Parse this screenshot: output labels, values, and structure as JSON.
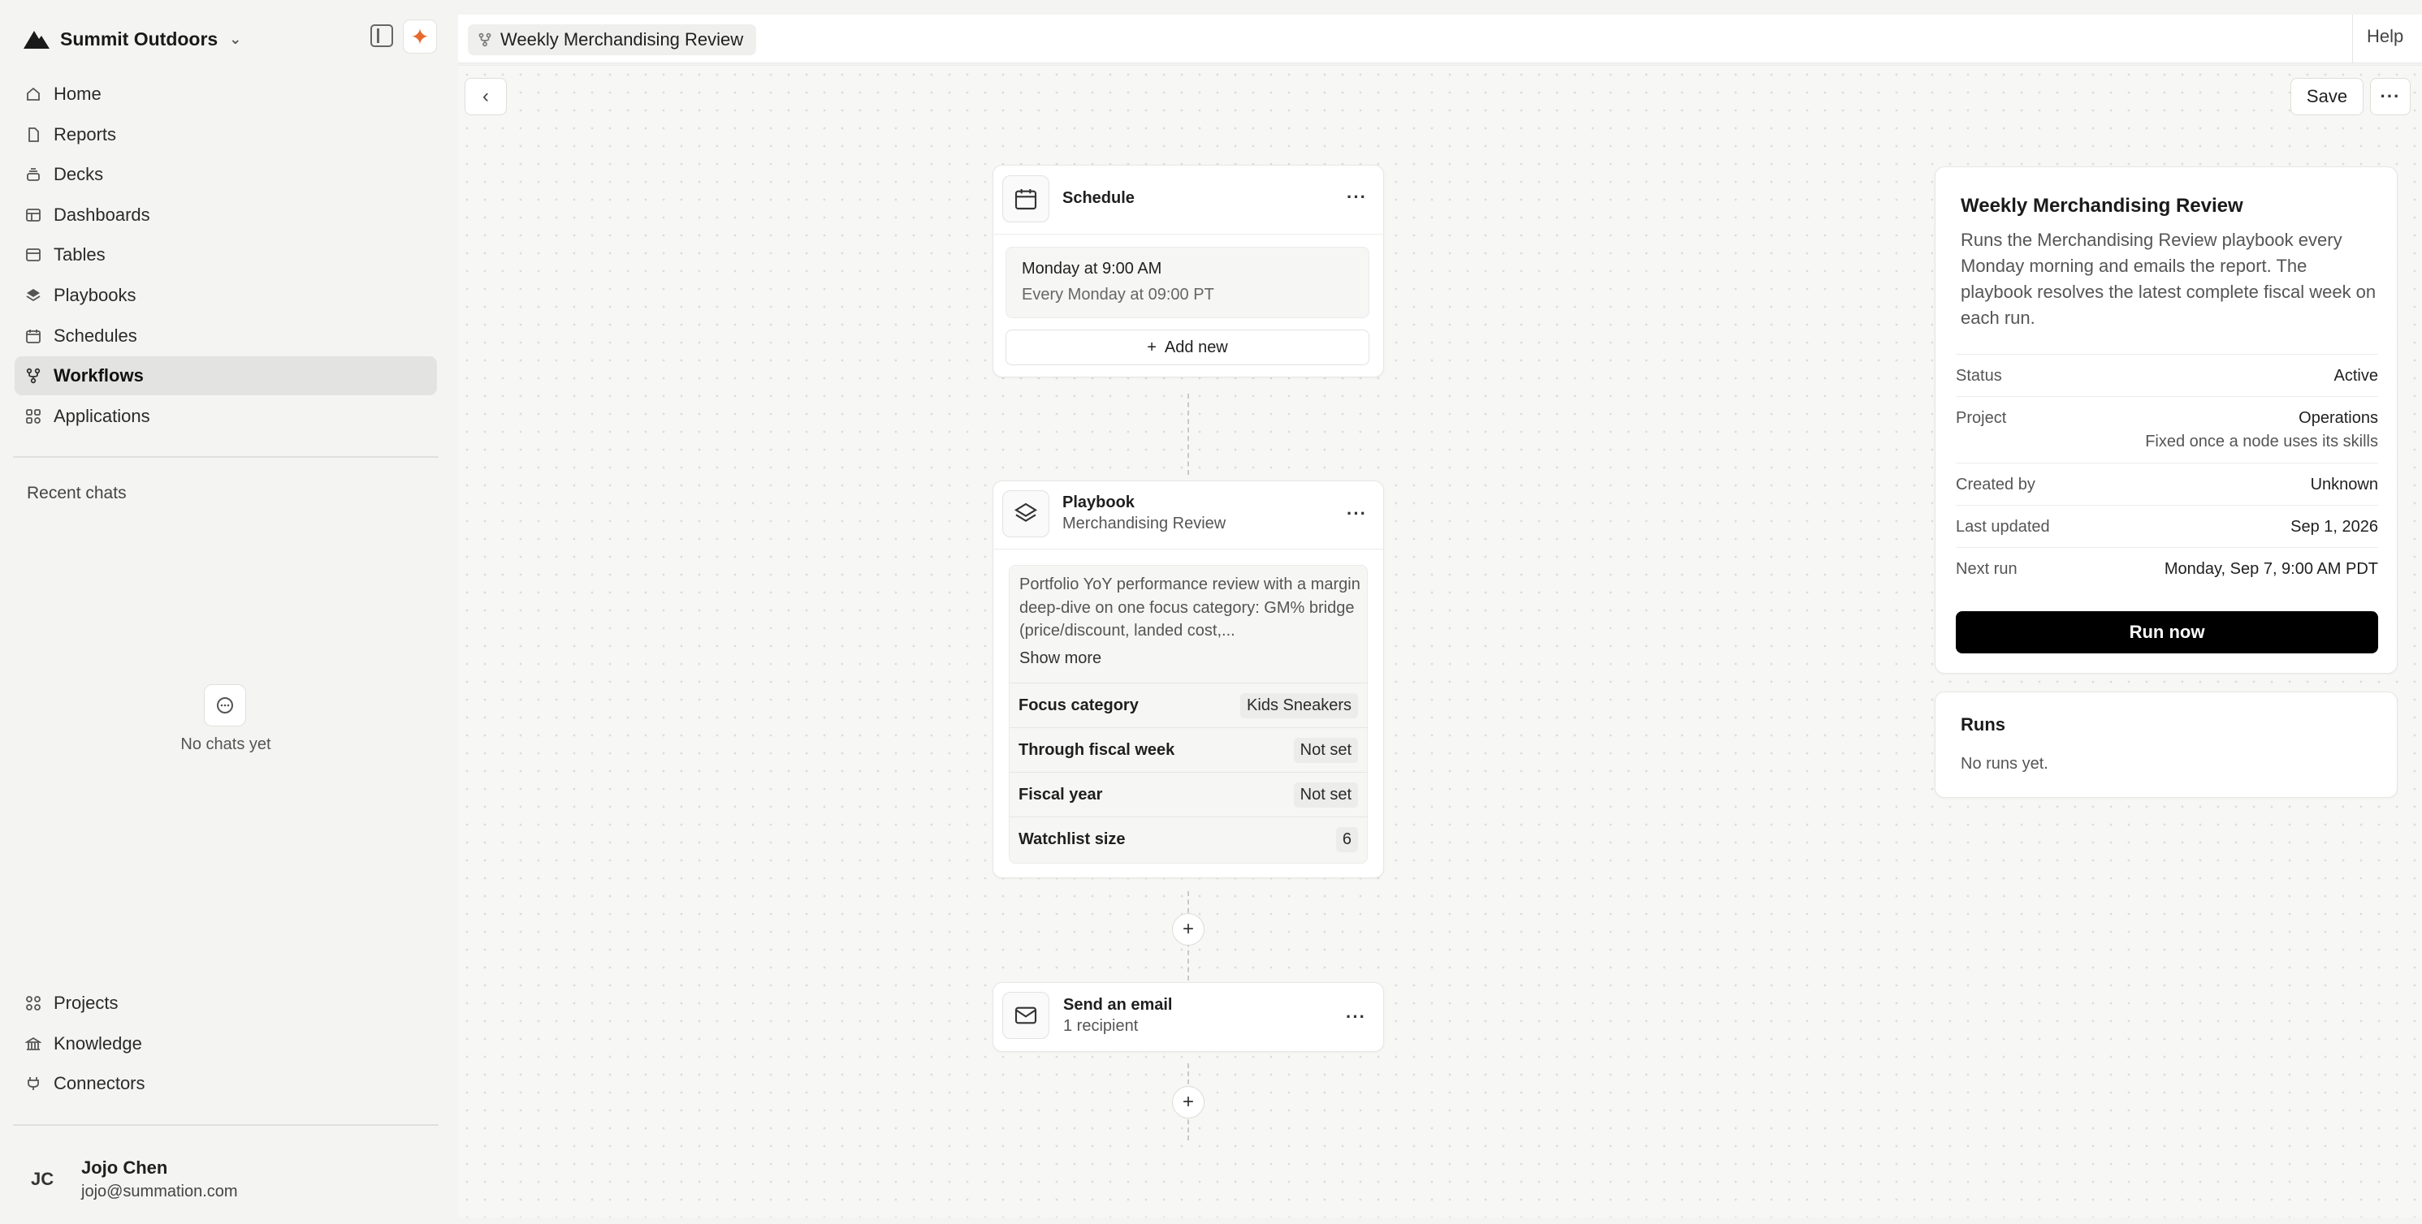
{
  "app": {
    "org_name": "Summit Outdoors",
    "help_label": "Help"
  },
  "sidebar": {
    "items": [
      {
        "label": "Home",
        "icon": "home-icon"
      },
      {
        "label": "Reports",
        "icon": "file-icon"
      },
      {
        "label": "Decks",
        "icon": "stack-icon"
      },
      {
        "label": "Dashboards",
        "icon": "layout-icon"
      },
      {
        "label": "Tables",
        "icon": "table-icon"
      },
      {
        "label": "Playbooks",
        "icon": "layers-icon"
      },
      {
        "label": "Schedules",
        "icon": "calendar-icon"
      },
      {
        "label": "Workflows",
        "icon": "workflow-icon",
        "active": true
      },
      {
        "label": "Applications",
        "icon": "grid-icon"
      }
    ],
    "recent_label": "Recent chats",
    "empty_chats": "No chats yet",
    "bottom_items": [
      {
        "label": "Projects",
        "icon": "grid-icon"
      },
      {
        "label": "Knowledge",
        "icon": "library-icon"
      },
      {
        "label": "Connectors",
        "icon": "plug-icon"
      }
    ],
    "user": {
      "initials": "JC",
      "name": "Jojo Chen",
      "email": "jojo@summation.com"
    }
  },
  "header": {
    "workflow_title": "Weekly Merchandising Review"
  },
  "toolbar": {
    "back_label": "‹",
    "save_label": "Save",
    "more_label": "···"
  },
  "nodes": {
    "schedule": {
      "title": "Schedule",
      "time_label": "Monday at 9:00 AM",
      "time_detail": "Every Monday at 09:00 PT",
      "add_label": "Add new"
    },
    "playbook": {
      "title": "Playbook",
      "subtitle": "Merchandising Review",
      "description": "Portfolio YoY performance review with a margin deep-dive on one focus category: GM% bridge (price/discount, landed cost,...",
      "show_more": "Show more",
      "params": [
        {
          "label": "Focus category",
          "value": "Kids Sneakers"
        },
        {
          "label": "Through fiscal week",
          "value": "Not set"
        },
        {
          "label": "Fiscal year",
          "value": "Not set"
        },
        {
          "label": "Watchlist size",
          "value": "6"
        }
      ]
    },
    "email": {
      "title": "Send an email",
      "subtitle": "1 recipient"
    }
  },
  "details": {
    "title": "Weekly Merchandising Review",
    "description": "Runs the Merchandising Review playbook every Monday morning and emails the report. The playbook resolves the latest complete fiscal week on each run.",
    "status_label": "Status",
    "status_value": "Active",
    "project_label": "Project",
    "project_value": "Operations",
    "project_note": "Fixed once a node uses its skills",
    "created_label": "Created by",
    "created_value": "Unknown",
    "updated_label": "Last updated",
    "updated_value": "Sep 1, 2026",
    "next_label": "Next run",
    "next_value": "Monday, Sep 7, 9:00 AM PDT",
    "run_label": "Run now"
  },
  "runs": {
    "title": "Runs",
    "empty": "No runs yet."
  },
  "colors": {
    "accent": "#e8692e",
    "primary_button": "#000000",
    "active_nav": "#e3e3e1"
  }
}
